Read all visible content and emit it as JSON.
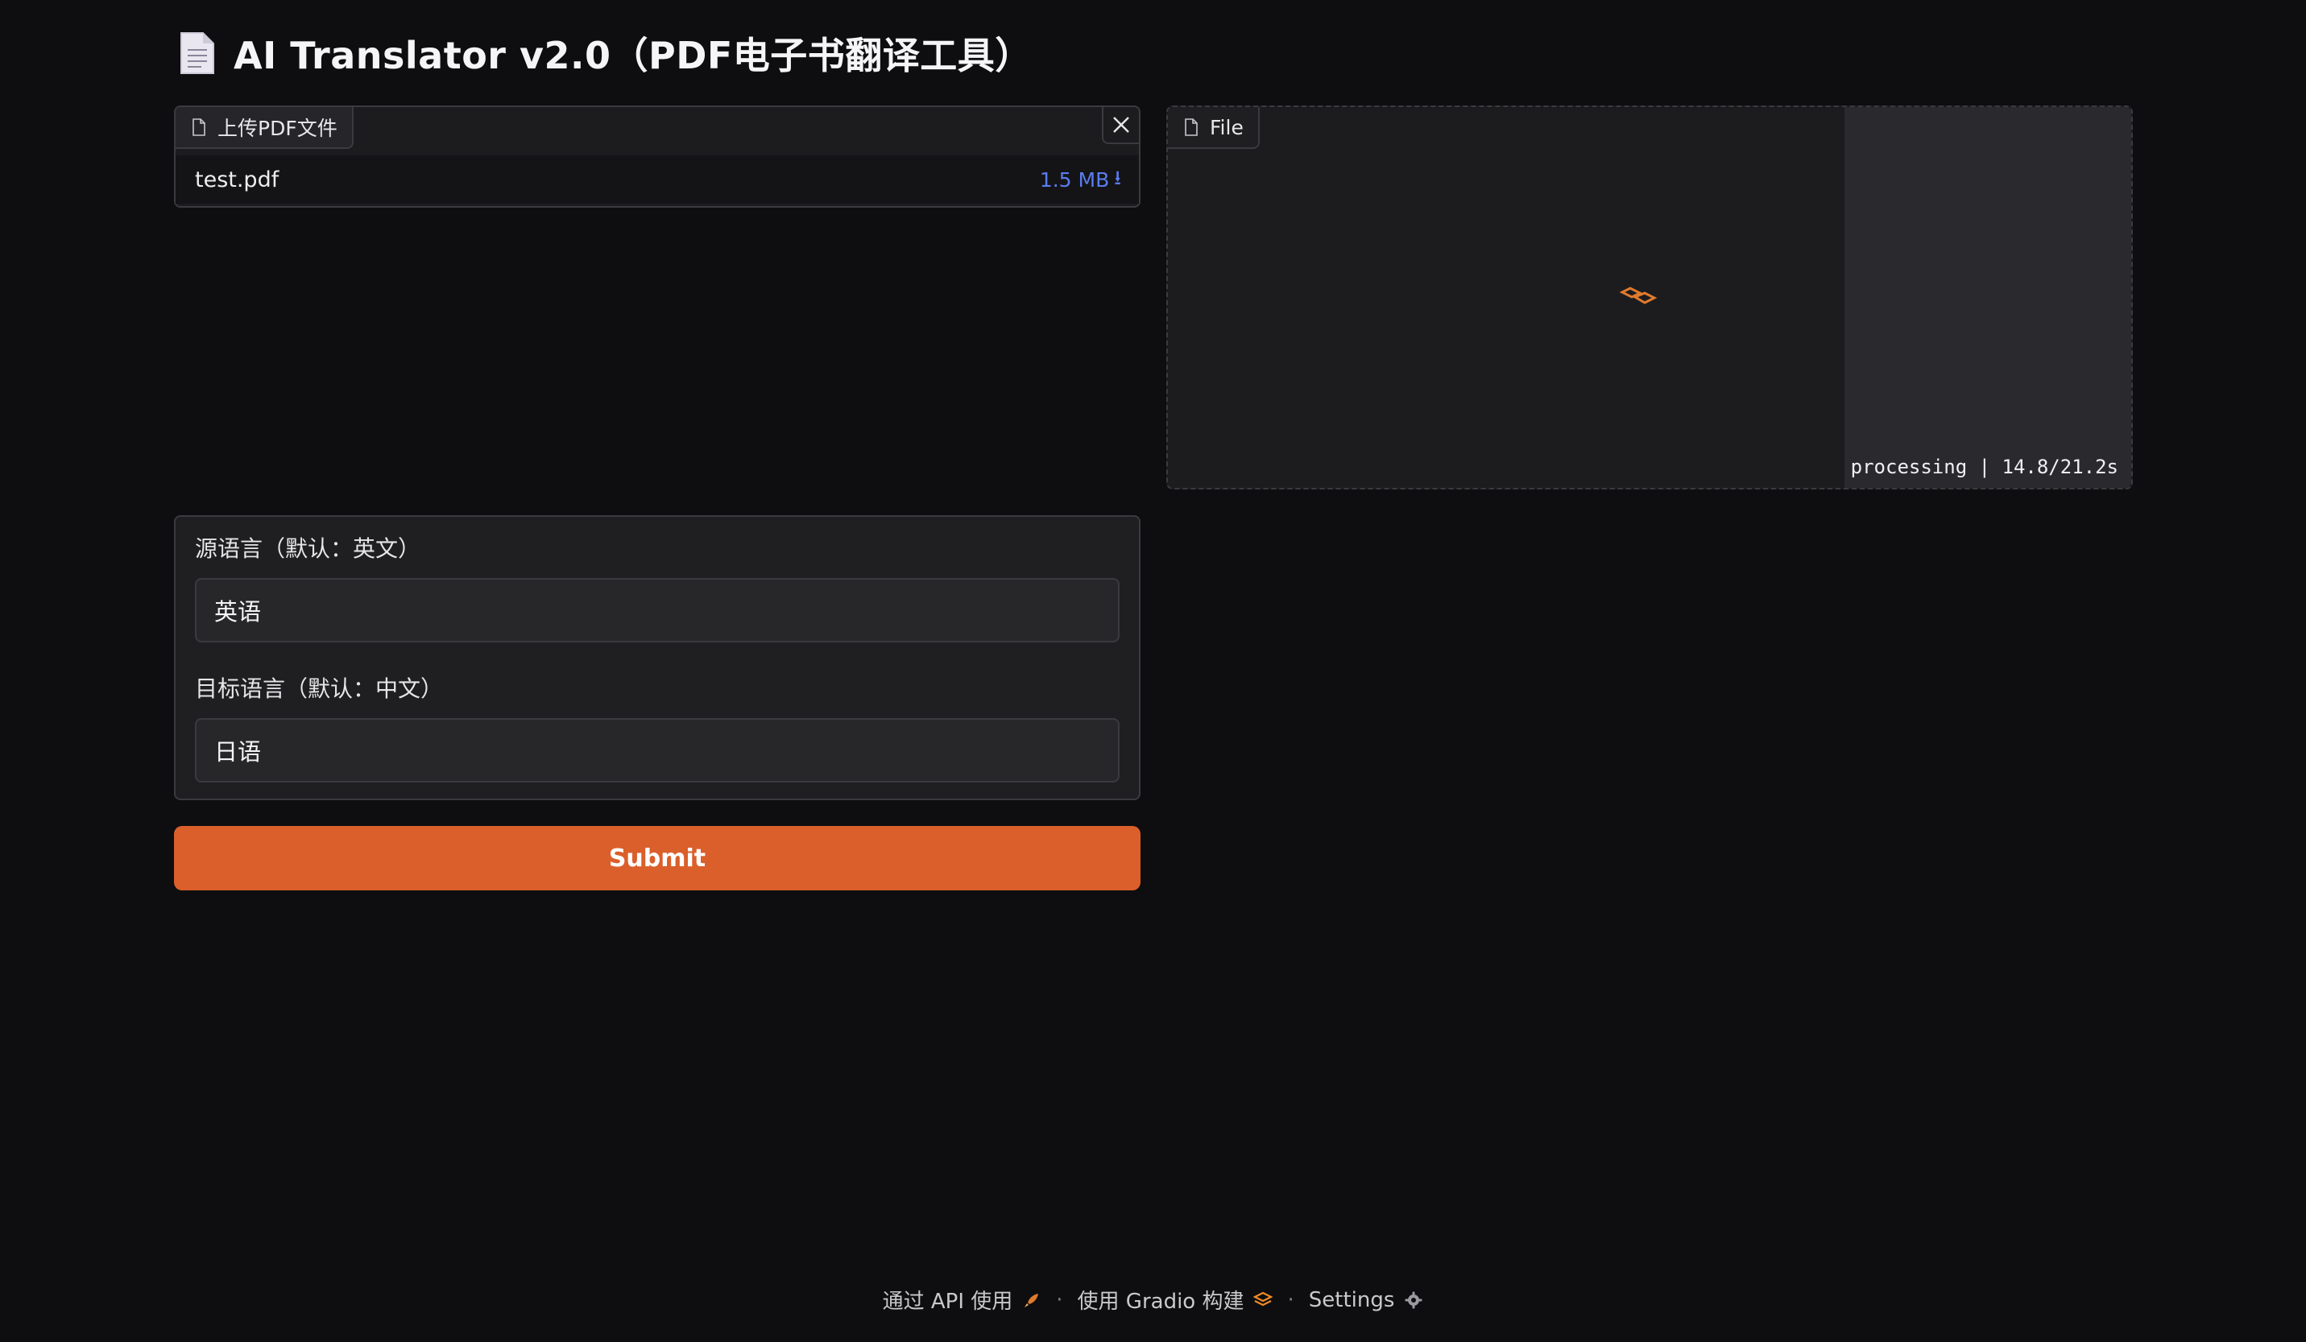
{
  "header": {
    "title": "AI Translator v2.0（PDF电子书翻译工具）",
    "icon": "document-icon"
  },
  "upload": {
    "label": "上传PDF文件",
    "file_name": "test.pdf",
    "file_size": "1.5 MB",
    "download_glyph": "⭳"
  },
  "output": {
    "label": "File",
    "status": "processing | 14.8/21.2s"
  },
  "form": {
    "source_label": "源语言（默认：英文）",
    "source_value": "英语",
    "target_label": "目标语言（默认：中文）",
    "target_value": "日语"
  },
  "submit": {
    "label": "Submit"
  },
  "footer": {
    "api": "通过 API 使用",
    "built": "使用 Gradio 构建",
    "settings": "Settings",
    "separator": "·"
  },
  "colors": {
    "accent": "#db5f2b",
    "link": "#5b7cf0",
    "background": "#0e0e10"
  }
}
